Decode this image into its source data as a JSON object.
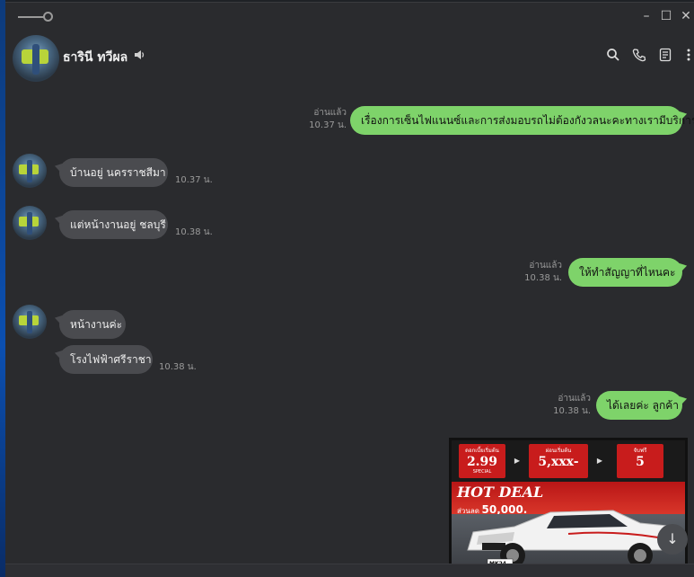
{
  "window": {
    "controls": {
      "minimize": "–",
      "maximize": "☐",
      "close": "✕"
    }
  },
  "header": {
    "contact_name": "ธารินี ทวีผล",
    "icons": [
      "search-icon",
      "phone-icon",
      "notes-icon",
      "more-icon"
    ]
  },
  "messages": [
    {
      "direction": "out",
      "text": "เรื่องการเซ็นไฟแนนซ์และการส่งมอบรถไม่ต้องกังวลนะคะทางเรามีบริการค่ะ",
      "read": "อ่านแล้ว",
      "time": "10.37 น."
    },
    {
      "direction": "in",
      "text": "บ้านอยู่ นครราชสีมา",
      "time": "10.37 น."
    },
    {
      "direction": "in",
      "text": "แต่หน้างานอยู่ ชลบุรี",
      "time": "10.38 น."
    },
    {
      "direction": "out",
      "text": "ให้ทำสัญญาที่ไหนคะ",
      "read": "อ่านแล้ว",
      "time": "10.38 น."
    },
    {
      "direction": "in",
      "text": "หน้างานค่ะ"
    },
    {
      "direction": "in",
      "text": "โรงไฟฟ้าศรีราชา",
      "time": "10.38 น."
    },
    {
      "direction": "out",
      "text": "ได้เลยค่ะ ลูกค้า",
      "read": "อ่านแล้ว",
      "time": "10.38 น."
    }
  ],
  "promo_image": {
    "rate": "2.99",
    "rate_label": "ดอกเบี้ยเริ่มต้น",
    "rate_note": "SPECIAL",
    "installment": "5,xxx-",
    "installment_label": "ผ่อนเริ่มต้น",
    "months": "5",
    "months_label": "จับฟรี",
    "headline": "HOT DEAL",
    "discount_prefix": "ส่วนลด",
    "discount": "50,000.",
    "plate": "MK24"
  },
  "scroll_down": "↓"
}
